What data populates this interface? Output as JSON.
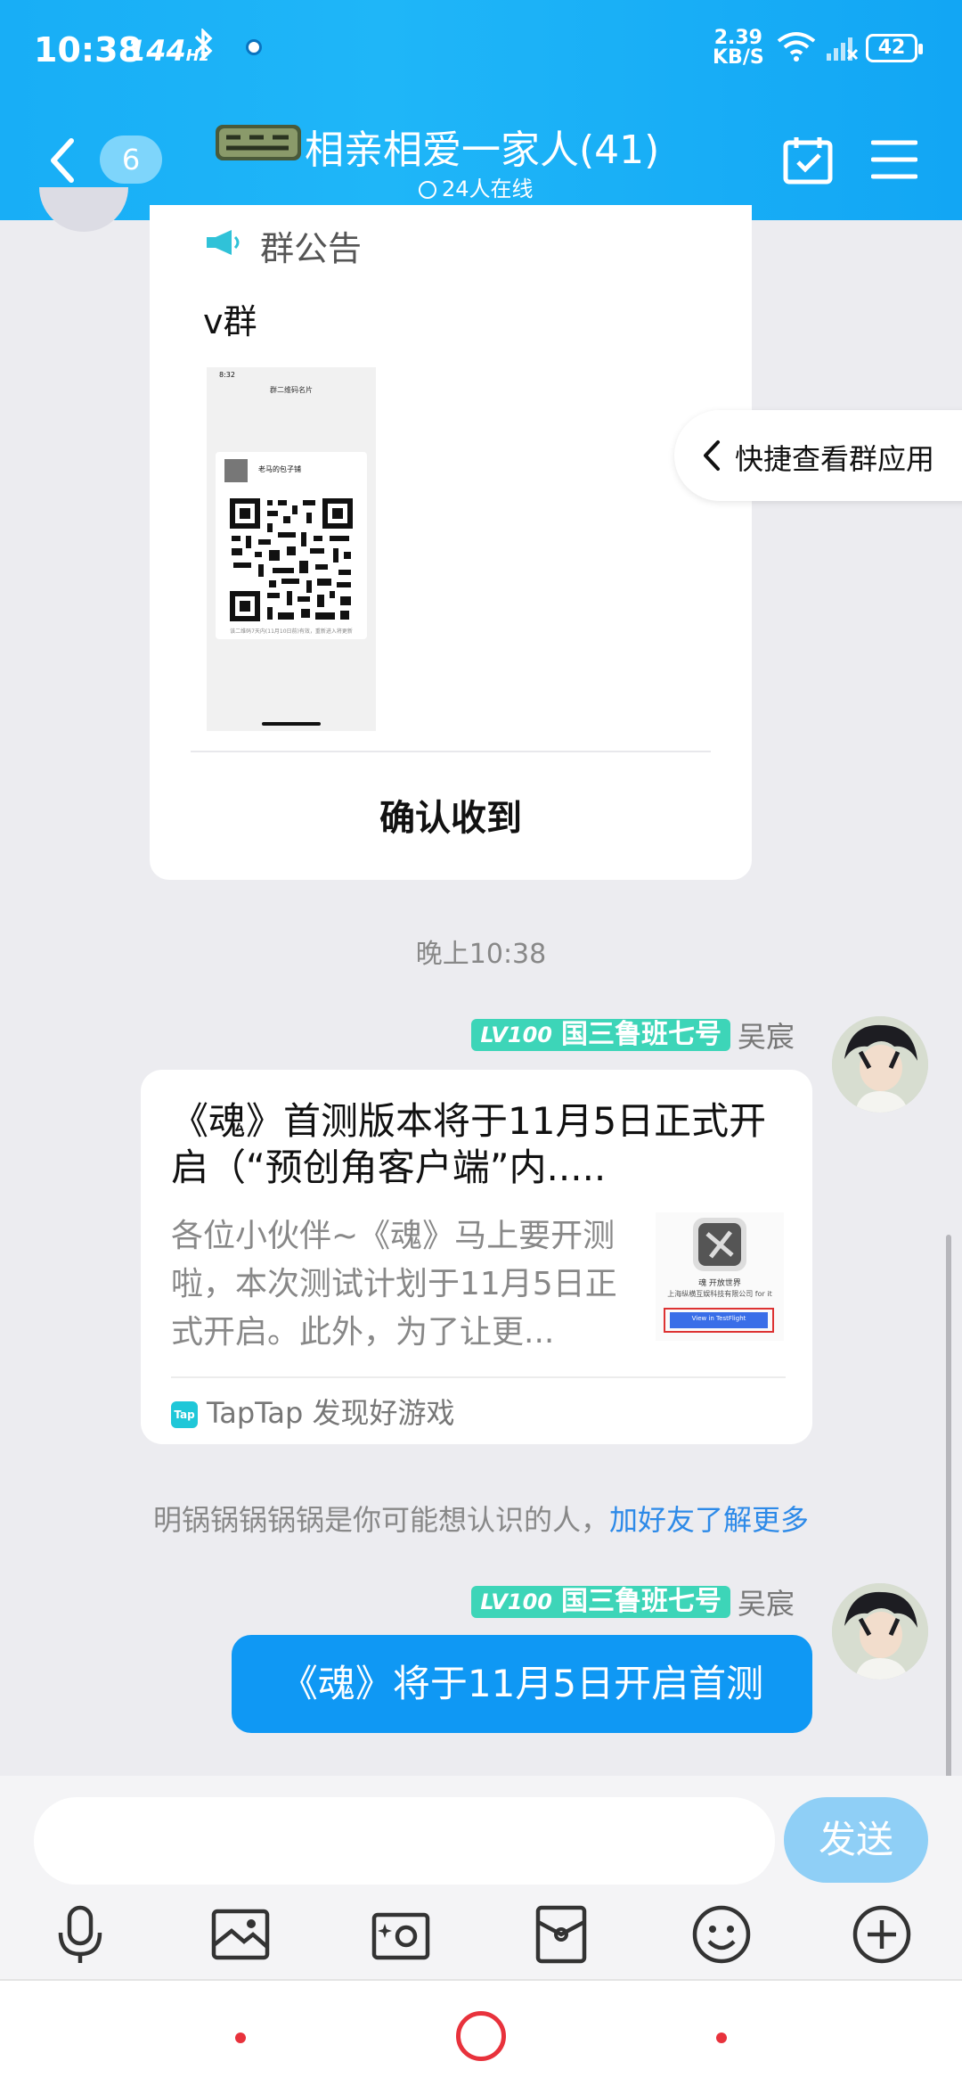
{
  "status_bar": {
    "time": "10:38",
    "refresh_rate": "144",
    "refresh_unit": "Hz",
    "net_speed_value": "2.39",
    "net_speed_unit": "KB/S",
    "battery": "42"
  },
  "header": {
    "back_count": "6",
    "title": "相亲相爱一家人(41)",
    "online": "24人在线"
  },
  "notice": {
    "heading": "群公告",
    "text": "v群",
    "confirm_label": "确认收到",
    "image_time": "8:32",
    "image_title": "群二维码名片",
    "image_name": "老马的包子铺",
    "image_footer": "该二维码7天内(11月10日前)有效，重新进入将更新"
  },
  "quick_view": {
    "label": "快捷查看群应用"
  },
  "chat": {
    "timestamp": "晚上10:38",
    "messages": [
      {
        "level": "LV100",
        "title": "国三鲁班七号",
        "sender": "吴宸",
        "card_title": "《魂》首测版本将于11月5日正式开启（“预创角客户端”内.....",
        "card_desc": "各位小伙伴~《魂》马上要开测啦，本次测试计划于11月5日正式开启。此外，为了让更...",
        "card_thumb_caption": "魂 开放世界",
        "card_thumb_company": "上海纵横互娱科技有限公司 for it",
        "card_thumb_button": "View in TestFlight",
        "source_icon": "Tap",
        "source": "TapTap 发现好游戏"
      },
      {
        "level": "LV100",
        "title": "国三鲁班七号",
        "sender": "吴宸",
        "text": "《魂》将于11月5日开启首测"
      }
    ],
    "suggestion_text": "明锅锅锅锅锅是你可能想认识的人，",
    "suggestion_link": "加好友了解更多"
  },
  "input": {
    "placeholder": "",
    "send_label": "发送"
  },
  "toolbar": [
    "mic-icon",
    "image-icon",
    "camera-icon",
    "red-packet-icon",
    "emoji-icon",
    "plus-icon"
  ],
  "colors": {
    "header_blue": "#18aef6",
    "bubble_blue": "#0f98f4",
    "badge_teal": "#3dd5b8",
    "link_blue": "#2d8ae8",
    "send_disabled": "#8fcff6"
  }
}
